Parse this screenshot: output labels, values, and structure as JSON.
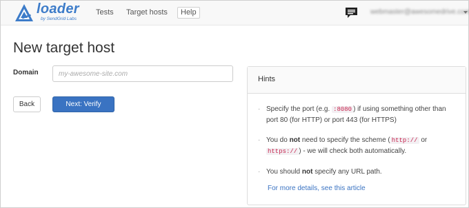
{
  "brand": {
    "name": "loader",
    "subtitle": "by SendGrid Labs"
  },
  "nav": {
    "tests": "Tests",
    "target_hosts": "Target hosts",
    "help": "Help",
    "user_email": "webmaster@awesomedrive.com"
  },
  "page": {
    "title": "New target host"
  },
  "form": {
    "domain_label": "Domain",
    "domain_placeholder": "my-awesome-site.com",
    "back_label": "Back",
    "next_label": "Next: Verify"
  },
  "hints": {
    "title": "Hints",
    "items": [
      {
        "text_before": "Specify the port (e.g. ",
        "code": ":8080",
        "text_after": ") if using something other than port 80 (for HTTP) or port 443 (for HTTPS)"
      },
      {
        "text_before": "You do ",
        "bold": "not",
        "text_middle": " need to specify the scheme (",
        "code_1": "http://",
        "text_or": " or ",
        "code_2": "https://",
        "text_after": ") - we will check both automatically."
      },
      {
        "text_before": "You should ",
        "bold": "not",
        "text_after": " specify any URL path."
      }
    ],
    "link": "For more details, see this article"
  },
  "colors": {
    "brand": "#3d7cc9",
    "primary_button": "#3a73c2",
    "code_text": "#c7254e"
  },
  "icons": {
    "logo": "loader-logo-icon",
    "chat": "chat-icon",
    "caret": "caret-down-icon"
  }
}
